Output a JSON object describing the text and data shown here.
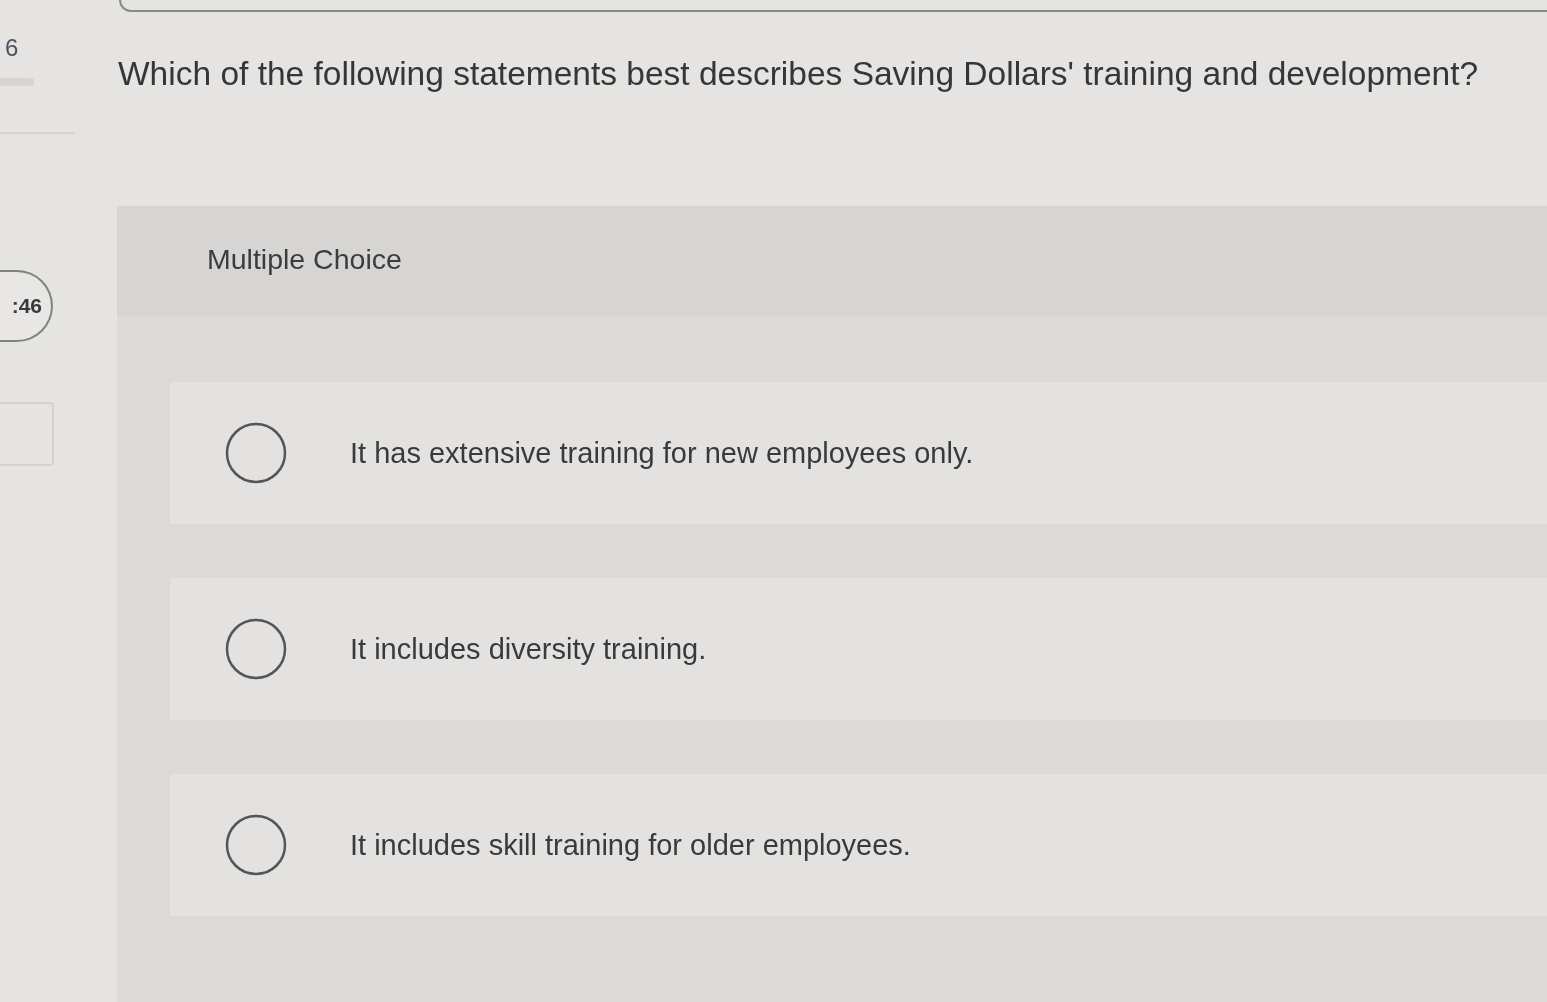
{
  "question": {
    "number": "6",
    "text": "Which of the following statements best describes Saving Dollars' training and development?"
  },
  "timer": {
    "time": ":46"
  },
  "answer": {
    "type_label": "Multiple Choice",
    "options": [
      {
        "text": "It has extensive training for new employees only.",
        "selected": false
      },
      {
        "text": "It includes diversity training.",
        "selected": false
      },
      {
        "text": "It includes skill training for older employees.",
        "selected": false
      }
    ]
  }
}
